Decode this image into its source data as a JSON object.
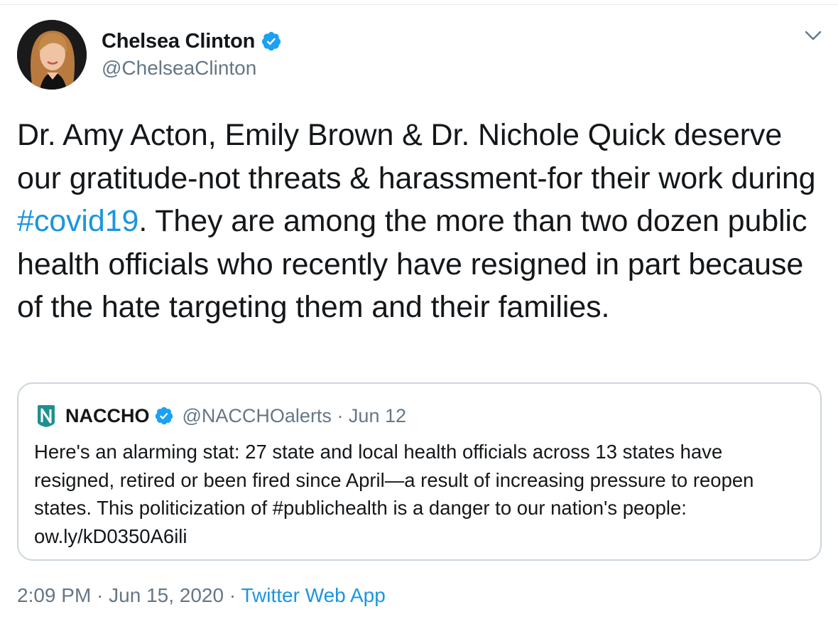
{
  "author": {
    "display_name": "Chelsea Clinton",
    "handle": "@ChelseaClinton",
    "verified": true
  },
  "tweet": {
    "text_before_hashtag": "Dr. Amy Acton, Emily Brown & Dr. Nichole Quick deserve our gratitude-not threats & harassment-for their work during ",
    "hashtag": "#covid19",
    "text_after_hashtag": ". They are among the more than two dozen public health officials who recently have resigned in part because of the hate targeting them and their families."
  },
  "quoted_tweet": {
    "display_name": "NACCHO",
    "meta": "@NACCHOalerts · Jun 12",
    "verified": true,
    "text": "Here's an alarming stat: 27 state and local health officials across 13 states have resigned, retired or been fired since April—a result of increasing pressure to reopen states. This politicization of #publichealth is a danger to our nation's people: ow.ly/kD0350A6ili"
  },
  "footer": {
    "timestamp": "2:09 PM · Jun 15, 2020 · ",
    "source": "Twitter Web App"
  },
  "icons": {
    "verified": "verified-badge-icon",
    "more": "chevron-down-icon",
    "quoted_logo": "naccho-logo-icon"
  },
  "colors": {
    "link": "#1b95e0",
    "verified": "#1da1f2",
    "secondary_text": "#657786",
    "border": "#ccd6dd",
    "primary_text": "#14171a"
  }
}
